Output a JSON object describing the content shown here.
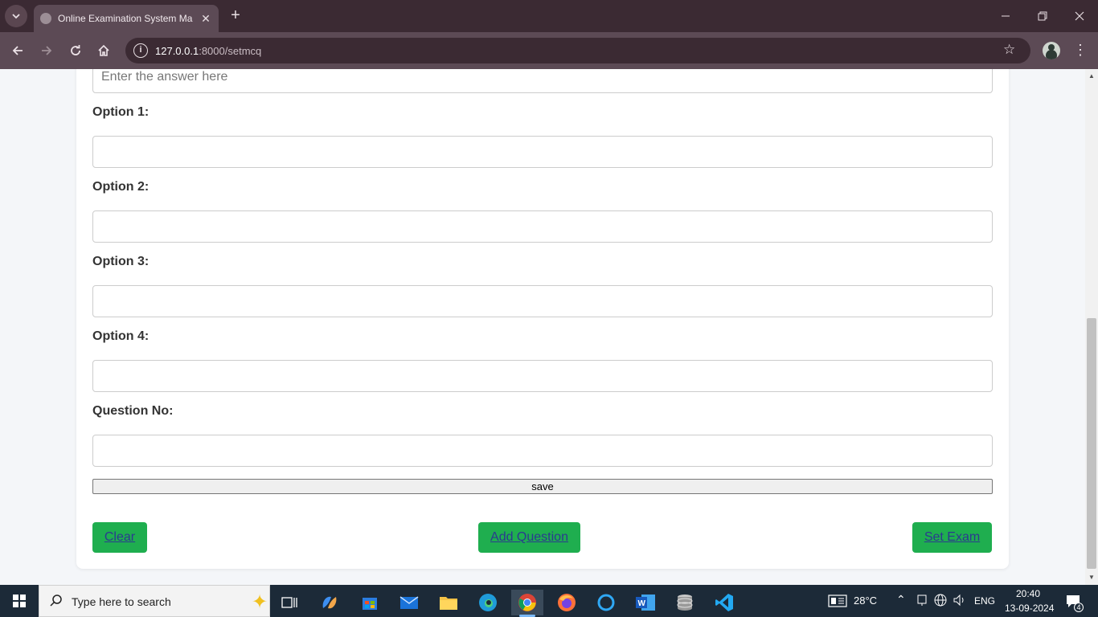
{
  "browser": {
    "tab_title": "Online Examination System Ma",
    "url_host": "127.0.0.1",
    "url_path": ":8000/setmcq",
    "new_tab_symbol": "+",
    "close_symbol": "✕"
  },
  "form": {
    "answer_placeholder": "Enter the answer here",
    "option1_label": "Option 1:",
    "option2_label": "Option 2:",
    "option3_label": "Option 3:",
    "option4_label": "Option 4:",
    "question_no_label": "Question No:",
    "save_label": "save"
  },
  "actions": {
    "clear_label": "Clear",
    "add_question_label": "Add Question",
    "set_exam_label": "Set Exam"
  },
  "taskbar": {
    "search_placeholder": "Type here to search",
    "temperature": "28°C",
    "language": "ENG",
    "time": "20:40",
    "date": "13-09-2024",
    "notification_count": "4"
  },
  "colors": {
    "accent_green": "#1fae4f",
    "link_blue": "#2b3a8f",
    "chrome_dark": "#3b2a33",
    "chrome_mid": "#5c4a55"
  },
  "icons": [
    "tab-search-icon",
    "globe-favicon-icon",
    "close-icon",
    "minimize-icon",
    "restore-icon",
    "back-icon",
    "forward-icon",
    "reload-icon",
    "home-icon",
    "site-info-icon",
    "bookmark-star-icon",
    "profile-avatar",
    "menu-dots-icon",
    "windows-start-icon",
    "search-icon",
    "copilot-icon",
    "task-view-icon",
    "chrome-icon",
    "firefox-icon",
    "edge-icon",
    "word-icon",
    "vscode-icon"
  ]
}
